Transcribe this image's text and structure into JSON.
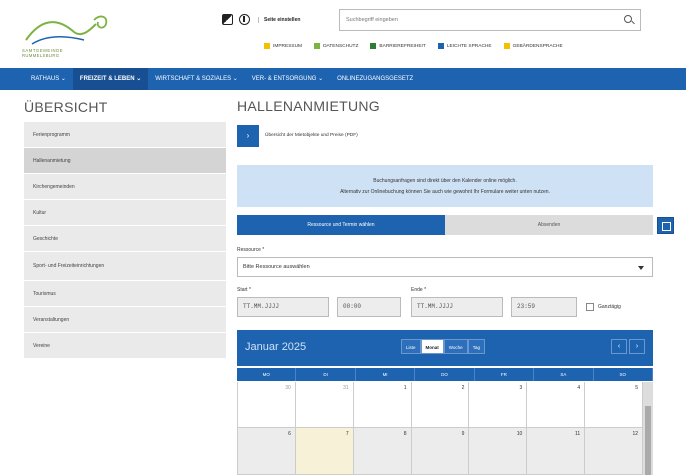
{
  "brand": {
    "line1": "SAMTGEMEINDE",
    "line2": "RUMMELSBURG"
  },
  "toolbar": {
    "settings_label": "Seite einstellen"
  },
  "search": {
    "placeholder": "Suchbegriff eingeben"
  },
  "quicklinks": [
    {
      "label": "Impressum",
      "color": "#f2c200"
    },
    {
      "label": "Datenschutz",
      "color": "#7cb342"
    },
    {
      "label": "Barrierefreiheit",
      "color": "#2e7d32"
    },
    {
      "label": "Leichte Sprache",
      "color": "#1e63b0"
    },
    {
      "label": "Gebärdensprache",
      "color": "#f2c200"
    }
  ],
  "nav": [
    {
      "label": "Rathaus ⌄"
    },
    {
      "label": "Freizeit & Leben ⌄"
    },
    {
      "label": "Wirtschaft & Soziales ⌄"
    },
    {
      "label": "Ver- & Entsorgung ⌄"
    },
    {
      "label": "Onlinezugangsgesetz"
    }
  ],
  "sidebar": {
    "title": "ÜBERSICHT",
    "items": [
      {
        "label": "Ferienprogramm"
      },
      {
        "label": "Hallenanmietung"
      },
      {
        "label": "Kirchengemeinden"
      },
      {
        "label": "Kultur"
      },
      {
        "label": "Geschichte"
      },
      {
        "label": "Sport- und Freizeiteinrichtungen"
      },
      {
        "label": "Tourismus"
      },
      {
        "label": "Veranstaltungen"
      },
      {
        "label": "Vereine"
      }
    ]
  },
  "main": {
    "title": "HALLENANMIETUNG",
    "pdf_label": "Übersicht der Mietobjekte und Preise (PDF)",
    "info_line1": "Buchungsanfragen sind direkt über den Kalender online möglich.",
    "info_line2": "Alternativ zur Onlinebuchung können Sie auch wie gewohnt Ihr Formulare weiter unten nutzen.",
    "tab_active": "Ressource und Termin wählen",
    "tab_inactive": "Absenden",
    "resource_label": "Ressource *",
    "resource_value": "Bitte Ressource auswählen",
    "start_label": "Start *",
    "end_label": "Ende *",
    "start_date": "TT.MM.JJJJ",
    "start_time": "00:00",
    "end_date": "TT.MM.JJJJ",
    "end_time": "23:59",
    "allday_label": "Ganztägig"
  },
  "calendar": {
    "month": "Januar 2025",
    "views": [
      "Liste",
      "Monat",
      "Woche",
      "Tag"
    ],
    "active_view": "Monat",
    "prev": "‹",
    "next": "›",
    "weekdays": [
      "Mo",
      "Di",
      "Mi",
      "Do",
      "Fr",
      "Sa",
      "So"
    ],
    "row1": [
      "30",
      "31",
      "1",
      "2",
      "3",
      "4",
      "5"
    ],
    "row2": [
      "6",
      "7",
      "8",
      "9",
      "10",
      "11",
      "12"
    ]
  }
}
